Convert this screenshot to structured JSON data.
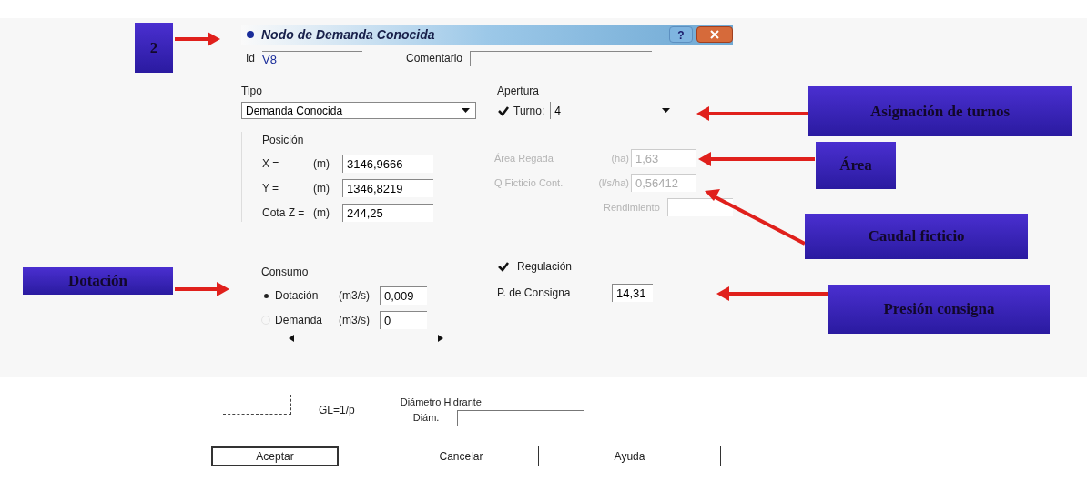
{
  "dialog": {
    "title": "Nodo de Demanda Conocida",
    "help_button": "?",
    "id": {
      "label": "Id",
      "value": "V8"
    },
    "comment": {
      "label": "Comentario"
    },
    "type": {
      "label": "Tipo",
      "value": "Demanda Conocida"
    },
    "opening": {
      "label": "Apertura",
      "turn": {
        "label": "Turno:",
        "checked": true,
        "value": "4"
      }
    },
    "position": {
      "label": "Posición",
      "fields": [
        {
          "label": "X =",
          "unit": "(m)",
          "value": "3146,9666"
        },
        {
          "label": "Y =",
          "unit": "(m)",
          "value": "1346,8219"
        },
        {
          "label": "Cota Z =",
          "unit": "(m)",
          "value": "244,25"
        }
      ]
    },
    "irrigation": {
      "disabled": true,
      "fields": [
        {
          "label": "Área Regada",
          "unit": "(ha)",
          "value": "1,63"
        },
        {
          "label": "Q Ficticio Cont.",
          "unit": "(l/s/ha)",
          "value": "0,56412"
        },
        {
          "label": "Rendimiento"
        }
      ]
    },
    "consumption": {
      "label": "Consumo",
      "options": [
        {
          "label": "Dotación",
          "unit": "(m3/s)",
          "value": "0,009",
          "selected": true
        },
        {
          "label": "Demanda",
          "unit": "(m3/s)",
          "value": "0",
          "selected": false
        }
      ]
    },
    "regulation": {
      "label": "Regulación",
      "checked": true,
      "setpoint": {
        "label": "P. de Consigna",
        "value": "14,31"
      }
    },
    "gl": "GL=1/p",
    "diameter": {
      "title": "Diámetro Hidrante",
      "label": "Diám."
    },
    "buttons": [
      {
        "label": "Aceptar",
        "default": true
      },
      {
        "label": "Cancelar",
        "default": false
      },
      {
        "label": "Ayuda",
        "default": false
      }
    ]
  },
  "callouts": [
    {
      "label": "2"
    },
    {
      "label": "Dotación"
    },
    {
      "label": "Asignación de turnos"
    },
    {
      "label": "Área"
    },
    {
      "label": "Caudal ficticio"
    },
    {
      "label": "Presión consigna"
    }
  ]
}
